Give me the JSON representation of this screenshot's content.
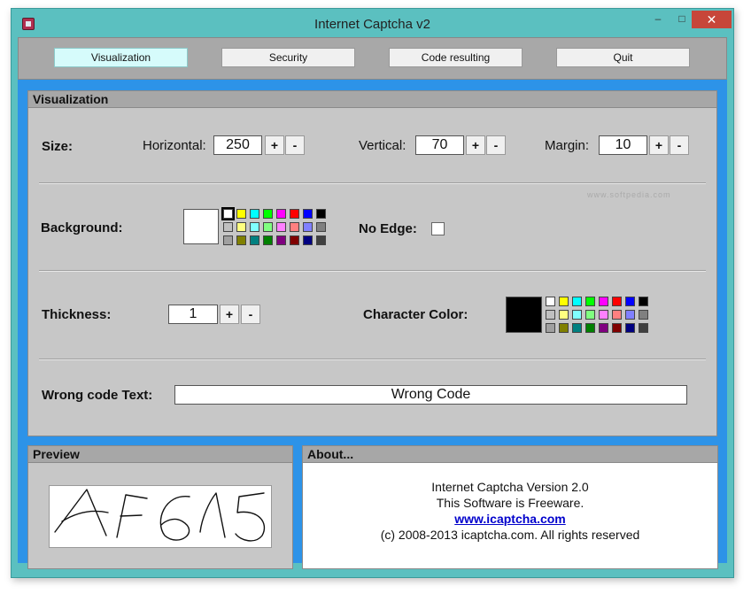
{
  "window": {
    "title": "Internet Captcha v2",
    "minimize": "–",
    "maximize": "□",
    "close": "✕"
  },
  "menu": {
    "visualization": "Visualization",
    "security": "Security",
    "code_resulting": "Code resulting",
    "quit": "Quit"
  },
  "visualization": {
    "header": "Visualization",
    "size_label": "Size:",
    "horizontal_label": "Horizontal:",
    "horizontal_value": "250",
    "vertical_label": "Vertical:",
    "vertical_value": "70",
    "margin_label": "Margin:",
    "margin_value": "10",
    "plus": "+",
    "minus": "-",
    "background_label": "Background:",
    "no_edge_label": "No Edge:",
    "thickness_label": "Thickness:",
    "thickness_value": "1",
    "character_color_label": "Character Color:",
    "wrong_code_label": "Wrong code Text:",
    "wrong_code_value": "Wrong Code",
    "watermark": "www.softpedia.com"
  },
  "palette_colors": [
    "#ffffff",
    "#ffff00",
    "#00ffff",
    "#00ff00",
    "#ff00ff",
    "#ff0000",
    "#0000ff",
    "#000000",
    "#c0c0c0",
    "#ffff80",
    "#80ffff",
    "#80ff80",
    "#ff80ff",
    "#ff8080",
    "#8080ff",
    "#808080",
    "#a0a0a0",
    "#808000",
    "#008080",
    "#008000",
    "#800080",
    "#800000",
    "#000080",
    "#404040"
  ],
  "background_color": "#ffffff",
  "character_color": "#000000",
  "preview": {
    "header": "Preview",
    "captcha_text": "AF615"
  },
  "about": {
    "header": "About...",
    "line1": "Internet Captcha Version 2.0",
    "line2": "This Software is Freeware.",
    "link": "www.icaptcha.com",
    "line4": "(c) 2008-2013 icaptcha.com. All rights reserved"
  }
}
